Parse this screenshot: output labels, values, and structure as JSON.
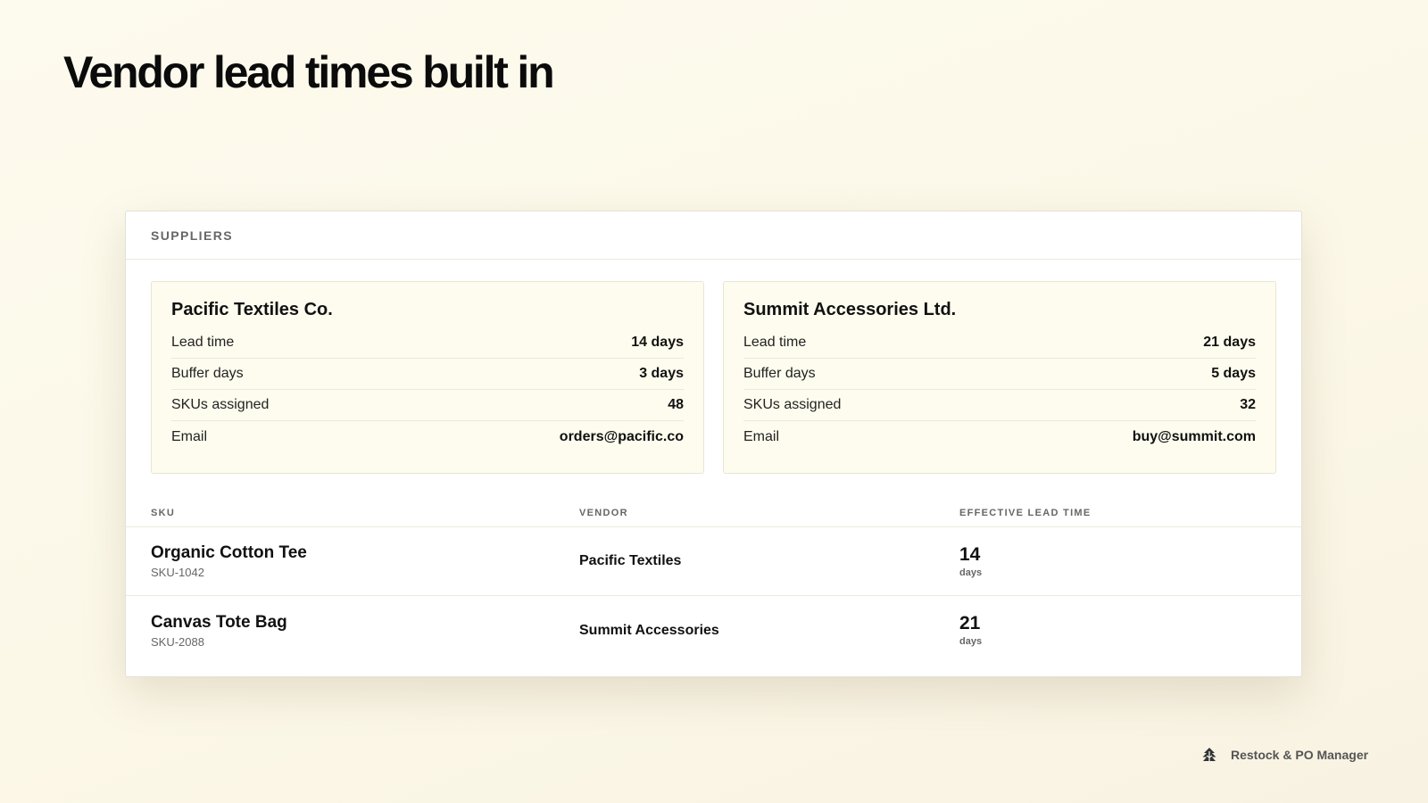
{
  "page": {
    "headline": "Vendor lead times built in"
  },
  "panel": {
    "title": "SUPPLIERS",
    "suppliers": [
      {
        "name": "Pacific Textiles Co.",
        "fields": [
          {
            "label": "Lead time",
            "value": "14 days"
          },
          {
            "label": "Buffer days",
            "value": "3 days"
          },
          {
            "label": "SKUs assigned",
            "value": "48"
          },
          {
            "label": "Email",
            "value": "orders@pacific.co"
          }
        ]
      },
      {
        "name": "Summit Accessories Ltd.",
        "fields": [
          {
            "label": "Lead time",
            "value": "21 days"
          },
          {
            "label": "Buffer days",
            "value": "5 days"
          },
          {
            "label": "SKUs assigned",
            "value": "32"
          },
          {
            "label": "Email",
            "value": "buy@summit.com"
          }
        ]
      }
    ],
    "table": {
      "headers": [
        "SKU",
        "VENDOR",
        "EFFECTIVE LEAD TIME"
      ],
      "rows": [
        {
          "name": "Organic Cotton Tee",
          "code": "SKU-1042",
          "vendor": "Pacific Textiles",
          "lead": "14",
          "unit": "days"
        },
        {
          "name": "Canvas Tote Bag",
          "code": "SKU-2088",
          "vendor": "Summit Accessories",
          "lead": "21",
          "unit": "days"
        }
      ]
    }
  },
  "brand": {
    "name": "Restock & PO Manager",
    "icon": "tree-logo-icon"
  }
}
